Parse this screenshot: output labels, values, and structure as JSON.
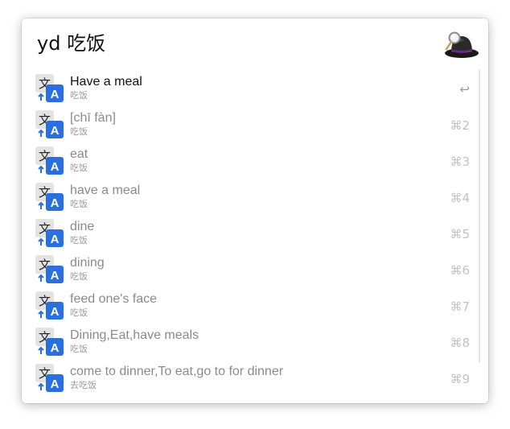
{
  "search": {
    "query": "yd 吃饭"
  },
  "app": {
    "logo_icon": "alfred-hat-icon"
  },
  "results": [
    {
      "title": "Have a meal",
      "subtitle": "吃饭",
      "shortcut": "↩",
      "icon": "translate-icon",
      "selected": true
    },
    {
      "title": "[chī fàn]",
      "subtitle": "吃饭",
      "shortcut": "⌘2",
      "icon": "translate-icon",
      "selected": false
    },
    {
      "title": "eat",
      "subtitle": "吃饭",
      "shortcut": "⌘3",
      "icon": "translate-icon",
      "selected": false
    },
    {
      "title": "have a meal",
      "subtitle": "吃饭",
      "shortcut": "⌘4",
      "icon": "translate-icon",
      "selected": false
    },
    {
      "title": "dine",
      "subtitle": "吃饭",
      "shortcut": "⌘5",
      "icon": "translate-icon",
      "selected": false
    },
    {
      "title": "dining",
      "subtitle": "吃饭",
      "shortcut": "⌘6",
      "icon": "translate-icon",
      "selected": false
    },
    {
      "title": "feed one's face",
      "subtitle": "吃饭",
      "shortcut": "⌘7",
      "icon": "translate-icon",
      "selected": false
    },
    {
      "title": "Dining,Eat,have meals",
      "subtitle": "吃饭",
      "shortcut": "⌘8",
      "icon": "translate-icon",
      "selected": false
    },
    {
      "title": "come to dinner,To eat,go to for dinner",
      "subtitle": "去吃饭",
      "shortcut": "⌘9",
      "icon": "translate-icon",
      "selected": false
    }
  ],
  "colors": {
    "icon_blue": "#2a6fde",
    "icon_gray": "#e3e3e3"
  }
}
